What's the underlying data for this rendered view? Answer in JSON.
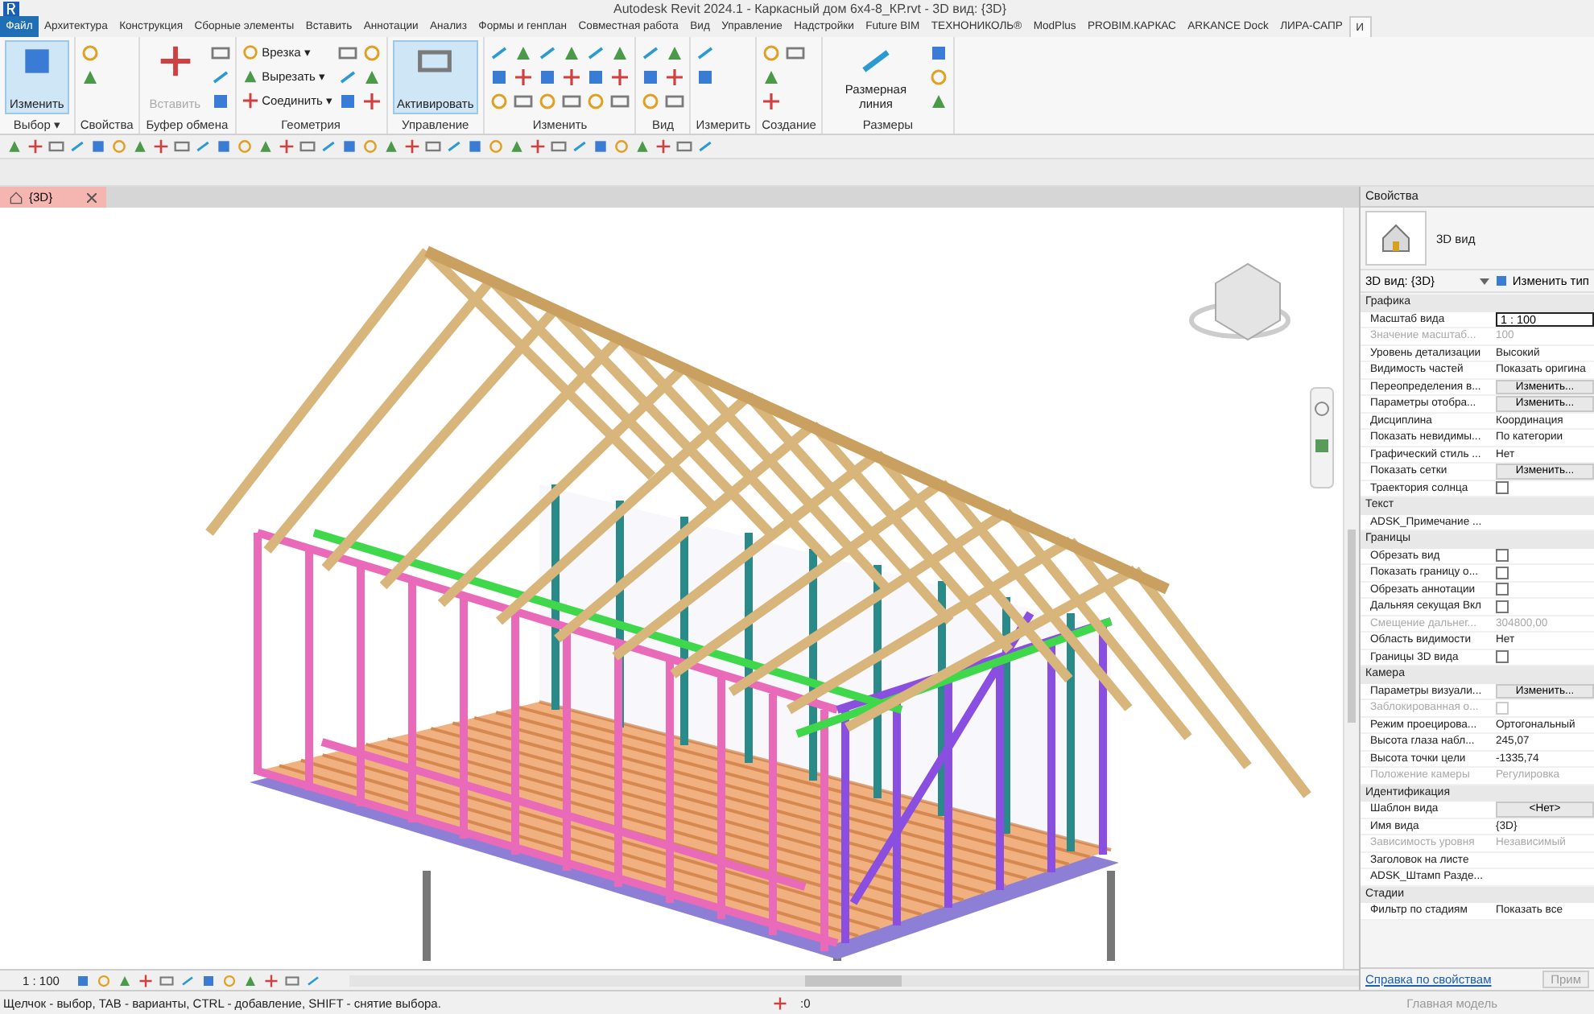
{
  "window": {
    "title": "Autodesk Revit 2024.1 - Каркасный дом 6х4-8_КР.rvt - 3D вид: {3D}"
  },
  "tabs": [
    {
      "label": "Файл",
      "kind": "file",
      "selected": false
    },
    {
      "label": "Архитектура",
      "kind": "tab",
      "selected": false
    },
    {
      "label": "Конструкция",
      "kind": "tab",
      "selected": false
    },
    {
      "label": "Сборные элементы",
      "kind": "tab",
      "selected": false
    },
    {
      "label": "Вставить",
      "kind": "tab",
      "selected": false
    },
    {
      "label": "Аннотации",
      "kind": "tab",
      "selected": false
    },
    {
      "label": "Анализ",
      "kind": "tab",
      "selected": false
    },
    {
      "label": "Формы и генплан",
      "kind": "tab",
      "selected": false
    },
    {
      "label": "Совместная работа",
      "kind": "tab",
      "selected": false
    },
    {
      "label": "Вид",
      "kind": "tab",
      "selected": false
    },
    {
      "label": "Управление",
      "kind": "tab",
      "selected": false
    },
    {
      "label": "Надстройки",
      "kind": "tab",
      "selected": false
    },
    {
      "label": "Future BIM",
      "kind": "tab",
      "selected": false
    },
    {
      "label": "ТЕХНОНИКОЛЬ®",
      "kind": "tab",
      "selected": false
    },
    {
      "label": "ModPlus",
      "kind": "tab",
      "selected": false
    },
    {
      "label": "PROBIM.КАРКАС",
      "kind": "tab",
      "selected": false
    },
    {
      "label": "ARKANCE Dock",
      "kind": "tab",
      "selected": false
    },
    {
      "label": "ЛИРА-САПР",
      "kind": "tab",
      "selected": false
    },
    {
      "label": "И",
      "kind": "tab",
      "selected": true
    }
  ],
  "ribbon": [
    {
      "label": "Выбор ▾",
      "items": [
        {
          "kind": "large",
          "label": "Изменить",
          "selected": true,
          "disabled": false
        }
      ]
    },
    {
      "label": "Свойства",
      "items": [
        {
          "kind": "icon"
        },
        {
          "kind": "icon"
        }
      ]
    },
    {
      "label": "Буфер обмена",
      "items": [
        {
          "kind": "large",
          "label": "Вставить",
          "selected": false,
          "disabled": true
        },
        {
          "kind": "icon"
        },
        {
          "kind": "icon"
        },
        {
          "kind": "icon"
        }
      ]
    },
    {
      "label": "Геометрия",
      "items": [
        {
          "kind": "small",
          "label": "Врезка ▾",
          "selected": false,
          "disabled": false
        },
        {
          "kind": "small",
          "label": "Вырезать ▾",
          "selected": false,
          "disabled": false
        },
        {
          "kind": "small",
          "label": "Соединить ▾",
          "selected": false,
          "disabled": false
        },
        {
          "kind": "icon"
        },
        {
          "kind": "icon"
        },
        {
          "kind": "icon"
        },
        {
          "kind": "icon"
        },
        {
          "kind": "icon"
        },
        {
          "kind": "icon"
        }
      ]
    },
    {
      "label": "Управление",
      "items": [
        {
          "kind": "large",
          "label": "Активировать",
          "selected": true,
          "disabled": false
        }
      ]
    },
    {
      "label": "Изменить",
      "items": [
        {
          "kind": "icon"
        },
        {
          "kind": "icon"
        },
        {
          "kind": "icon"
        },
        {
          "kind": "icon"
        },
        {
          "kind": "icon"
        },
        {
          "kind": "icon"
        },
        {
          "kind": "icon"
        },
        {
          "kind": "icon"
        },
        {
          "kind": "icon"
        },
        {
          "kind": "icon"
        },
        {
          "kind": "icon"
        },
        {
          "kind": "icon"
        },
        {
          "kind": "icon"
        },
        {
          "kind": "icon"
        },
        {
          "kind": "icon"
        },
        {
          "kind": "icon"
        },
        {
          "kind": "icon"
        },
        {
          "kind": "icon"
        }
      ]
    },
    {
      "label": "Вид",
      "items": [
        {
          "kind": "icon"
        },
        {
          "kind": "icon"
        },
        {
          "kind": "icon"
        },
        {
          "kind": "icon"
        },
        {
          "kind": "icon"
        },
        {
          "kind": "icon"
        }
      ]
    },
    {
      "label": "Измерить",
      "items": [
        {
          "kind": "icon"
        },
        {
          "kind": "icon"
        }
      ]
    },
    {
      "label": "Создание",
      "items": [
        {
          "kind": "icon"
        },
        {
          "kind": "icon"
        },
        {
          "kind": "icon"
        },
        {
          "kind": "icon"
        }
      ]
    },
    {
      "label": "Размеры",
      "items": [
        {
          "kind": "large",
          "label": "Размерная линия",
          "selected": false,
          "disabled": false
        },
        {
          "kind": "icon"
        },
        {
          "kind": "icon"
        },
        {
          "kind": "icon"
        }
      ]
    }
  ],
  "view_tabs": [
    {
      "label": "{3D}",
      "selected": true
    }
  ],
  "view_control_bar": {
    "scale": "1 : 100"
  },
  "properties": {
    "title": "Свойства",
    "type_name": "3D вид",
    "type_selector": "3D вид: {3D}",
    "edit_type": "Изменить тип",
    "rows": [
      {
        "kind": "header",
        "label": "Графика"
      },
      {
        "kind": "field",
        "label": "Масштаб вида",
        "value": "1 : 100",
        "disabled": false
      },
      {
        "kind": "text",
        "label": "Значение масштаб...",
        "value": "100",
        "disabled": true
      },
      {
        "kind": "text",
        "label": "Уровень детализации",
        "value": "Высокий",
        "disabled": false
      },
      {
        "kind": "text",
        "label": "Видимость частей",
        "value": "Показать оригина",
        "disabled": false
      },
      {
        "kind": "button",
        "label": "Переопределения в...",
        "value": "Изменить...",
        "disabled": false
      },
      {
        "kind": "button",
        "label": "Параметры отобра...",
        "value": "Изменить...",
        "disabled": false
      },
      {
        "kind": "text",
        "label": "Дисциплина",
        "value": "Координация",
        "disabled": false
      },
      {
        "kind": "text",
        "label": "Показать невидимы...",
        "value": "По категории",
        "disabled": false
      },
      {
        "kind": "text",
        "label": "Графический стиль ...",
        "value": "Нет",
        "disabled": false
      },
      {
        "kind": "button",
        "label": "Показать сетки",
        "value": "Изменить...",
        "disabled": false
      },
      {
        "kind": "check",
        "label": "Траектория солнца",
        "checked": false,
        "disabled": false
      },
      {
        "kind": "header",
        "label": "Текст"
      },
      {
        "kind": "text",
        "label": "ADSK_Примечание ...",
        "disabled": false
      },
      {
        "kind": "header",
        "label": "Границы"
      },
      {
        "kind": "check",
        "label": "Обрезать вид",
        "checked": false,
        "disabled": false
      },
      {
        "kind": "check",
        "label": "Показать границу о...",
        "checked": false,
        "disabled": false
      },
      {
        "kind": "check",
        "label": "Обрезать аннотации",
        "checked": false,
        "disabled": false
      },
      {
        "kind": "check",
        "label": "Дальняя секущая Вкл",
        "checked": false,
        "disabled": false
      },
      {
        "kind": "text",
        "label": "Смещение дальнег...",
        "value": "304800,00",
        "disabled": true
      },
      {
        "kind": "text",
        "label": "Область видимости",
        "value": "Нет",
        "disabled": false
      },
      {
        "kind": "check",
        "label": "Границы 3D вида",
        "checked": false,
        "disabled": false
      },
      {
        "kind": "header",
        "label": "Камера"
      },
      {
        "kind": "button",
        "label": "Параметры визуали...",
        "value": "Изменить...",
        "disabled": false
      },
      {
        "kind": "check",
        "label": "Заблокированная о...",
        "checked": false,
        "disabled": true
      },
      {
        "kind": "text",
        "label": "Режим проецирова...",
        "value": "Ортогональный",
        "disabled": false
      },
      {
        "kind": "text",
        "label": "Высота глаза набл...",
        "value": "245,07",
        "disabled": false
      },
      {
        "kind": "text",
        "label": "Высота точки цели",
        "value": "-1335,74",
        "disabled": false
      },
      {
        "kind": "text",
        "label": "Положение камеры",
        "value": "Регулировка",
        "disabled": true
      },
      {
        "kind": "header",
        "label": "Идентификация"
      },
      {
        "kind": "button",
        "label": "Шаблон вида",
        "value": "<Нет>",
        "disabled": false
      },
      {
        "kind": "text",
        "label": "Имя вида",
        "value": "{3D}",
        "disabled": false
      },
      {
        "kind": "text",
        "label": "Зависимость уровня",
        "value": "Независимый",
        "disabled": true
      },
      {
        "kind": "text",
        "label": "Заголовок на листе",
        "disabled": false
      },
      {
        "kind": "text",
        "label": "ADSK_Штамп Разде...",
        "disabled": false
      },
      {
        "kind": "header",
        "label": "Стадии"
      },
      {
        "kind": "text",
        "label": "Фильтр по стадиям",
        "value": "Показать все",
        "disabled": false
      }
    ],
    "help_link": "Справка по свойствам",
    "apply_button": "Прим"
  },
  "status_bar": {
    "message": "Щелчок - выбор, TAB - варианты, CTRL - добавление, SHIFT - снятие выбора.",
    "model": "Главная модель",
    "count": ":0"
  }
}
